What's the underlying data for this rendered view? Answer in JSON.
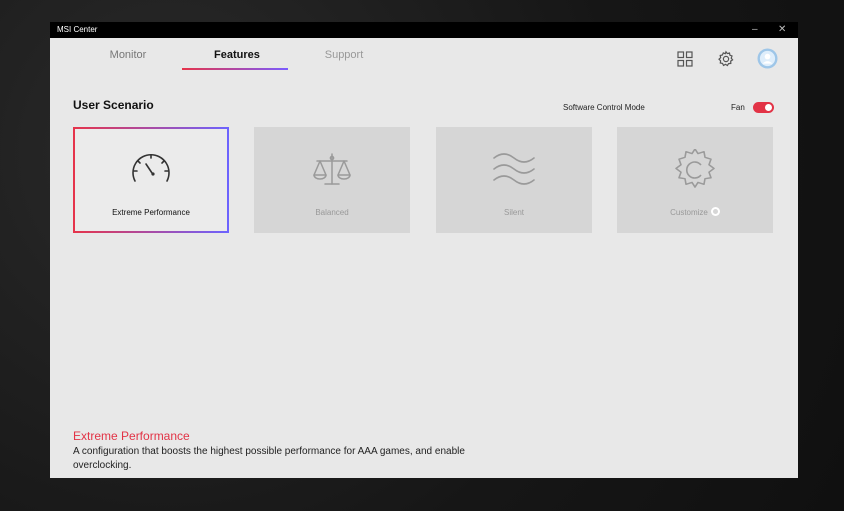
{
  "window": {
    "title": "MSI Center",
    "minimize_glyph": "–",
    "close_glyph": "✕"
  },
  "nav": {
    "tabs": [
      {
        "label": "Monitor"
      },
      {
        "label": "Features"
      },
      {
        "label": "Support"
      }
    ],
    "active_tab": "Features",
    "icons": [
      "apps-grid-icon",
      "settings-gear-icon",
      "user-avatar-icon"
    ]
  },
  "scenario": {
    "title": "User Scenario",
    "mode_label": "Software Control Mode",
    "fan_label": "Fan",
    "fan_on": true,
    "cards": [
      {
        "label": "Extreme Performance",
        "icon": "speedometer-icon",
        "selected": true
      },
      {
        "label": "Balanced",
        "icon": "scale-icon",
        "selected": false
      },
      {
        "label": "Silent",
        "icon": "waves-icon",
        "selected": false
      },
      {
        "label": "Customize",
        "icon": "gear-icon",
        "selected": false
      }
    ]
  },
  "description": {
    "title": "Extreme Performance",
    "text": "A configuration that boosts the highest possible performance for AAA games, and enable overclocking."
  },
  "colors": {
    "accent": "#e23346",
    "accent2": "#6c63ff",
    "background": "#e8e8e8"
  }
}
